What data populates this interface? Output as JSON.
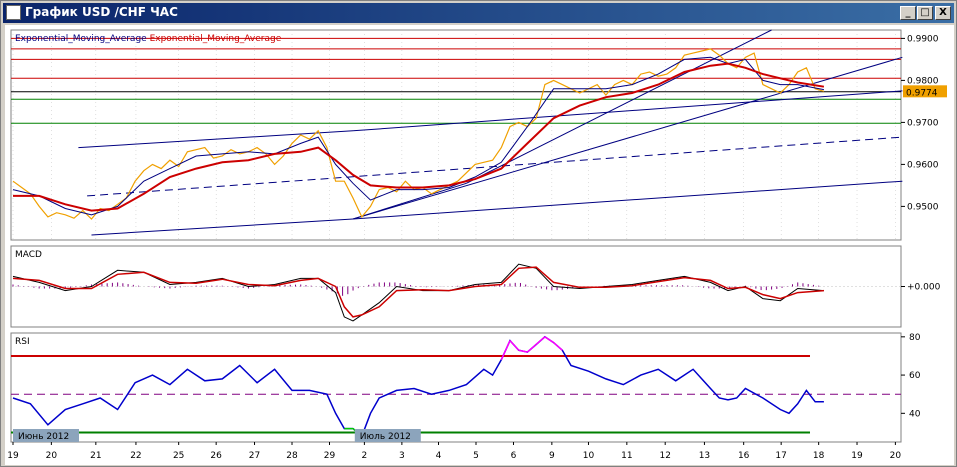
{
  "window": {
    "title": "График USD /CHF ЧАС",
    "minimize_label": "_",
    "maximize_label": "□",
    "close_label": "X"
  },
  "colors": {
    "price": "#f0a000",
    "ema_fast": "#000080",
    "ema_slow": "#cc0000",
    "resistance": "#cc0000",
    "support": "#008000",
    "trend": "#000080",
    "macd_hist": "#800080",
    "rsi": "#0000cc",
    "rsi_overbought": "#ff00ff",
    "rsi_oversold": "#00cc00",
    "last_price_bg": "#f0a000"
  },
  "chart_data": [
    {
      "type": "line",
      "panel": "price",
      "legend": [
        {
          "name": "Exponential_Moving_Average",
          "color": "#000080"
        },
        {
          "name": "Exponential_Moving_Average",
          "color": "#cc0000"
        }
      ],
      "ylim": [
        0.942,
        0.992
      ],
      "yticks": [
        "0.9900",
        "0.9800",
        "0.9700",
        "0.9600",
        "0.9500"
      ],
      "last_price": "0.9774",
      "x_index_range": [
        0,
        100
      ],
      "x_tick_labels": [
        {
          "label": "19",
          "x": 0
        },
        {
          "label": "20",
          "x": 4.4
        },
        {
          "label": "21",
          "x": 9.5
        },
        {
          "label": "22",
          "x": 14.1
        },
        {
          "label": "25",
          "x": 19.0
        },
        {
          "label": "26",
          "x": 23.3
        },
        {
          "label": "27",
          "x": 27.7
        },
        {
          "label": "28",
          "x": 32.0
        },
        {
          "label": "29",
          "x": 36.3
        },
        {
          "label": "2",
          "x": 40.3
        },
        {
          "label": "3",
          "x": 44.6
        },
        {
          "label": "4",
          "x": 48.8
        },
        {
          "label": "5",
          "x": 53.1
        },
        {
          "label": "6",
          "x": 57.4
        },
        {
          "label": "9",
          "x": 61.8
        },
        {
          "label": "10",
          "x": 66.0
        },
        {
          "label": "11",
          "x": 70.4
        },
        {
          "label": "12",
          "x": 74.8
        },
        {
          "label": "13",
          "x": 79.3
        },
        {
          "label": "16",
          "x": 83.8
        },
        {
          "label": "17",
          "x": 88.1
        },
        {
          "label": "18",
          "x": 92.4
        },
        {
          "label": "19",
          "x": 96.8
        },
        {
          "label": "20",
          "x": 101.2
        }
      ],
      "date_labels": [
        {
          "label": "Июнь 2012",
          "x": 0
        },
        {
          "label": "Июль 2012",
          "x": 39.2
        }
      ],
      "series": [
        {
          "role": "price",
          "x": [
            0,
            1,
            2,
            3,
            4,
            5,
            6,
            7,
            8,
            9,
            10,
            11,
            12,
            13,
            14,
            15,
            16,
            17,
            18,
            19,
            20,
            21,
            22,
            23,
            24,
            25,
            26,
            27,
            28,
            29,
            30,
            31,
            32,
            33,
            34,
            35,
            36,
            37,
            38,
            39,
            40,
            41,
            42,
            43,
            44,
            45,
            46,
            47,
            48,
            49,
            50,
            51,
            52,
            53,
            54,
            55,
            56,
            57,
            58,
            59,
            60,
            61,
            62,
            63,
            64,
            65,
            66,
            67,
            68,
            69,
            70,
            71,
            72,
            73,
            74,
            75,
            76,
            77,
            78,
            79,
            80,
            81,
            82,
            83,
            84,
            85,
            86,
            87,
            88,
            89,
            90,
            91,
            92,
            93
          ],
          "y": [
            0.956,
            0.9545,
            0.953,
            0.95,
            0.9475,
            0.9485,
            0.948,
            0.9472,
            0.949,
            0.947,
            0.9495,
            0.949,
            0.9505,
            0.952,
            0.956,
            0.9585,
            0.96,
            0.959,
            0.961,
            0.9595,
            0.963,
            0.9635,
            0.964,
            0.9615,
            0.962,
            0.9635,
            0.9625,
            0.963,
            0.964,
            0.9625,
            0.96,
            0.962,
            0.965,
            0.967,
            0.966,
            0.968,
            0.964,
            0.956,
            0.956,
            0.952,
            0.9475,
            0.95,
            0.954,
            0.9545,
            0.9535,
            0.956,
            0.954,
            0.9545,
            0.953,
            0.954,
            0.955,
            0.956,
            0.958,
            0.96,
            0.9605,
            0.961,
            0.964,
            0.969,
            0.97,
            0.969,
            0.971,
            0.979,
            0.98,
            0.979,
            0.978,
            0.977,
            0.978,
            0.979,
            0.9765,
            0.979,
            0.98,
            0.979,
            0.9815,
            0.982,
            0.981,
            0.9815,
            0.983,
            0.986,
            0.9865,
            0.987,
            0.9875,
            0.986,
            0.984,
            0.983,
            0.9855,
            0.9865,
            0.979,
            0.978,
            0.977,
            0.979,
            0.982,
            0.983,
            0.978,
            0.9774
          ]
        },
        {
          "role": "ema_fast",
          "x": [
            0,
            3,
            6,
            9,
            12,
            15,
            18,
            21,
            24,
            27,
            30,
            33,
            35,
            37,
            39,
            41,
            44,
            47,
            50,
            53,
            56,
            59,
            62,
            65,
            68,
            71,
            74,
            77,
            80,
            82,
            84,
            86,
            88,
            90,
            93
          ],
          "y": [
            0.954,
            0.9525,
            0.9495,
            0.948,
            0.95,
            0.956,
            0.959,
            0.962,
            0.9625,
            0.963,
            0.9625,
            0.965,
            0.9665,
            0.96,
            0.9555,
            0.9515,
            0.954,
            0.954,
            0.9545,
            0.957,
            0.9605,
            0.969,
            0.978,
            0.978,
            0.978,
            0.979,
            0.9815,
            0.985,
            0.9855,
            0.984,
            0.985,
            0.98,
            0.979,
            0.979,
            0.9778
          ]
        },
        {
          "role": "ema_slow",
          "x": [
            0,
            3,
            6,
            9,
            12,
            15,
            18,
            21,
            24,
            27,
            30,
            33,
            35,
            37,
            39,
            41,
            44,
            47,
            50,
            53,
            56,
            59,
            62,
            65,
            68,
            71,
            74,
            77,
            80,
            82,
            84,
            86,
            88,
            90,
            93
          ],
          "y": [
            0.9525,
            0.9525,
            0.9505,
            0.949,
            0.9495,
            0.953,
            0.957,
            0.959,
            0.9605,
            0.961,
            0.9625,
            0.963,
            0.964,
            0.961,
            0.9575,
            0.955,
            0.9545,
            0.9545,
            0.955,
            0.9565,
            0.959,
            0.965,
            0.971,
            0.974,
            0.976,
            0.977,
            0.979,
            0.982,
            0.9835,
            0.984,
            0.983,
            0.9815,
            0.9805,
            0.9795,
            0.9785
          ]
        }
      ],
      "horizontal_levels": [
        {
          "y": 0.99,
          "color": "#cc0000"
        },
        {
          "y": 0.9875,
          "color": "#cc0000"
        },
        {
          "y": 0.985,
          "color": "#cc0000"
        },
        {
          "y": 0.9805,
          "color": "#cc0000"
        },
        {
          "y": 0.9773,
          "color": "#000000"
        },
        {
          "y": 0.9755,
          "color": "#008000"
        },
        {
          "y": 0.9698,
          "color": "#008000"
        }
      ],
      "trendlines": [
        {
          "x1": 7.5,
          "y1": 0.964,
          "x2": 39,
          "y2": 0.968,
          "style": "solid"
        },
        {
          "x1": 39,
          "y1": 0.968,
          "x2": 102,
          "y2": 0.9775,
          "style": "solid"
        },
        {
          "x1": 8.5,
          "y1": 0.9525,
          "x2": 102,
          "y2": 0.9665,
          "style": "dashed"
        },
        {
          "x1": 9,
          "y1": 0.9432,
          "x2": 39,
          "y2": 0.947,
          "style": "solid"
        },
        {
          "x1": 39,
          "y1": 0.947,
          "x2": 102,
          "y2": 0.956,
          "style": "solid"
        },
        {
          "x1": 39,
          "y1": 0.947,
          "x2": 52,
          "y2": 0.9555,
          "style": "solid"
        },
        {
          "x1": 52,
          "y1": 0.9555,
          "x2": 87,
          "y2": 0.992,
          "style": "solid"
        },
        {
          "x1": 39,
          "y1": 0.947,
          "x2": 102,
          "y2": 0.9855,
          "style": "solid"
        }
      ]
    },
    {
      "type": "line",
      "panel": "macd",
      "title": "MACD",
      "yticks": [
        "+0.000"
      ],
      "ylim": [
        -1,
        1
      ],
      "series": [
        {
          "role": "macd",
          "x": [
            0,
            3,
            6,
            9,
            12,
            15,
            18,
            21,
            24,
            27,
            30,
            33,
            35,
            37,
            38,
            39,
            40,
            42,
            44,
            47,
            50,
            53,
            56,
            58,
            60,
            62,
            65,
            68,
            71,
            74,
            77,
            80,
            82,
            84,
            86,
            88,
            90,
            93
          ],
          "y": [
            0.25,
            0.1,
            -0.1,
            0.0,
            0.4,
            0.35,
            0.05,
            0.1,
            0.2,
            0.0,
            0.05,
            0.2,
            0.2,
            -0.15,
            -0.75,
            -0.85,
            -0.7,
            -0.4,
            0.0,
            -0.1,
            -0.1,
            0.05,
            0.1,
            0.55,
            0.45,
            0.0,
            -0.05,
            0.0,
            0.05,
            0.15,
            0.25,
            0.1,
            -0.1,
            0.0,
            -0.3,
            -0.35,
            -0.05,
            -0.1
          ]
        },
        {
          "role": "signal",
          "x": [
            0,
            3,
            6,
            9,
            12,
            15,
            18,
            21,
            24,
            27,
            30,
            33,
            35,
            37,
            38,
            39,
            40,
            42,
            44,
            47,
            50,
            53,
            56,
            58,
            60,
            62,
            65,
            68,
            71,
            74,
            77,
            80,
            82,
            84,
            86,
            88,
            90,
            93
          ],
          "y": [
            0.2,
            0.15,
            -0.05,
            -0.05,
            0.3,
            0.35,
            0.1,
            0.08,
            0.18,
            0.05,
            0.02,
            0.15,
            0.2,
            0.0,
            -0.5,
            -0.75,
            -0.7,
            -0.5,
            -0.1,
            -0.08,
            -0.1,
            0.0,
            0.05,
            0.45,
            0.48,
            0.1,
            -0.02,
            -0.02,
            0.02,
            0.12,
            0.22,
            0.15,
            -0.05,
            -0.02,
            -0.2,
            -0.3,
            -0.15,
            -0.1
          ]
        },
        {
          "role": "histogram",
          "x": [
            0,
            3,
            6,
            9,
            12,
            15,
            18,
            21,
            24,
            27,
            30,
            33,
            35,
            37,
            38,
            39,
            40,
            42,
            44,
            47,
            50,
            53,
            56,
            58,
            60,
            62,
            65,
            68,
            71,
            74,
            77,
            80,
            82,
            84,
            86,
            88,
            90,
            93
          ],
          "y": [
            0.05,
            -0.05,
            -0.05,
            0.05,
            0.1,
            0.0,
            -0.05,
            0.02,
            0.02,
            -0.05,
            0.03,
            0.05,
            0.0,
            -0.15,
            -0.25,
            -0.1,
            0.0,
            0.1,
            0.1,
            -0.02,
            0.0,
            0.05,
            0.05,
            0.1,
            -0.03,
            -0.1,
            -0.03,
            0.02,
            0.03,
            0.03,
            0.03,
            -0.05,
            -0.05,
            0.02,
            -0.1,
            -0.05,
            0.1,
            0.0
          ]
        }
      ]
    },
    {
      "type": "line",
      "panel": "rsi",
      "title": "RSI",
      "ylim": [
        25,
        82
      ],
      "yticks": [
        "80",
        "60",
        "40"
      ],
      "levels": [
        70,
        50,
        30
      ],
      "series": [
        {
          "role": "rsi",
          "x": [
            0,
            2,
            4,
            6,
            8,
            10,
            12,
            14,
            16,
            18,
            20,
            22,
            24,
            26,
            28,
            30,
            32,
            34,
            36,
            37,
            38,
            39,
            40,
            41,
            42,
            44,
            46,
            48,
            50,
            52,
            54,
            55,
            56,
            57,
            58,
            59,
            60,
            61,
            62,
            63,
            64,
            66,
            68,
            70,
            72,
            74,
            76,
            78,
            80,
            81,
            82,
            83,
            84,
            86,
            88,
            89,
            90,
            91,
            92,
            93
          ],
          "y": [
            48,
            45,
            34,
            42,
            45,
            48,
            42,
            56,
            60,
            55,
            63,
            57,
            58,
            65,
            56,
            63,
            52,
            52,
            50,
            40,
            32,
            32,
            28,
            40,
            48,
            52,
            53,
            50,
            52,
            55,
            63,
            60,
            68,
            78,
            73,
            72,
            76,
            80,
            77,
            73,
            65,
            62,
            58,
            55,
            60,
            63,
            57,
            63,
            53,
            48,
            47,
            48,
            53,
            48,
            42,
            40,
            45,
            52,
            46,
            46
          ]
        }
      ]
    }
  ]
}
